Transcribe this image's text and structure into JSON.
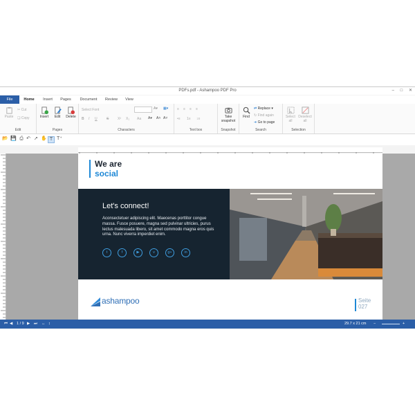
{
  "window": {
    "title": "PDFs.pdf - Ashampoo PDF Pro"
  },
  "tabs": [
    "File",
    "Home",
    "Insert",
    "Pages",
    "Document",
    "Review",
    "View"
  ],
  "ribbon": {
    "edit": {
      "label": "Edit",
      "paste": "Paste",
      "cut": "Cut",
      "copy": "Copy"
    },
    "pages": {
      "label": "Pages",
      "insert": "Insert",
      "edit": "Edit",
      "delete": "Delete"
    },
    "characters": {
      "label": "Characters",
      "font": "Select Font"
    },
    "textbox": {
      "label": "Text box"
    },
    "snapshot": {
      "label": "Snapshot",
      "take": "Take",
      "take2": "snapshot"
    },
    "search": {
      "label": "Search",
      "find": "Find",
      "replace": "Replace",
      "find_again": "Find again",
      "goto": "Go to page"
    },
    "selection": {
      "label": "Selection",
      "select_all": "Select",
      "select_all2": "all",
      "deselect_all": "Deselect",
      "deselect_all2": "all"
    }
  },
  "document": {
    "heading_line1": "We are",
    "heading_line2": "social",
    "connect_title": "Let's connect!",
    "paragraph": "Aconsectetuer adipiscing elit. Maecenas porttitor congue massa. Fusce posuere, magna sed pulvinar ultricies, purus lectus malesuada libero, sit amet commodo magna eros quis urna. Nunc viverra imperdiet enim.",
    "social_icons": [
      "twitter-icon",
      "facebook-icon",
      "youtube-icon",
      "vimeo-icon",
      "google-plus-icon",
      "linkedin-icon"
    ],
    "logo": "ashampoo",
    "seite_label": "Seite",
    "seite_number": "027"
  },
  "status": {
    "page": "1 / 9",
    "size": "29.7 x 21 cm"
  },
  "colors": {
    "accent": "#1e88d6",
    "dark_panel": "#162430",
    "statusbar": "#2b5ea7"
  }
}
